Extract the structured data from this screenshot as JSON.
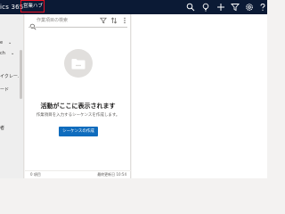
{
  "header": {
    "app_title": "ics 365",
    "area_label": "営業ハブ",
    "icons": [
      "search-icon",
      "lightbulb-icon",
      "add-icon",
      "filter-icon",
      "settings-icon",
      "help-icon",
      "more-icon"
    ]
  },
  "sidebar": {
    "items": [
      {
        "label": "e",
        "icon": "chevron-down-icon"
      },
      {
        "label": ""
      },
      {
        "label": "ch",
        "icon": "chevron-down-icon"
      },
      {
        "label": "イクレー..."
      },
      {
        "label": "ード"
      },
      {
        "label": ""
      },
      {
        "label": ""
      },
      {
        "label": ""
      },
      {
        "label": "者"
      }
    ]
  },
  "worklist": {
    "search_placeholder": "作業項目の検索",
    "toolbar_icons": [
      "filter-icon",
      "sort-icon",
      "more-icon"
    ],
    "empty_title": "活動がここに表示されます",
    "empty_subtitle": "作業項目を入力するシーケンスを作成します。",
    "create_button": "シーケンスの作成",
    "item_count": "0 項目",
    "last_updated": "最終更新日 10:54"
  },
  "colors": {
    "header_bg": "#0b1a35",
    "highlight_border": "#e81123",
    "primary_button": "#0f6cbd"
  }
}
